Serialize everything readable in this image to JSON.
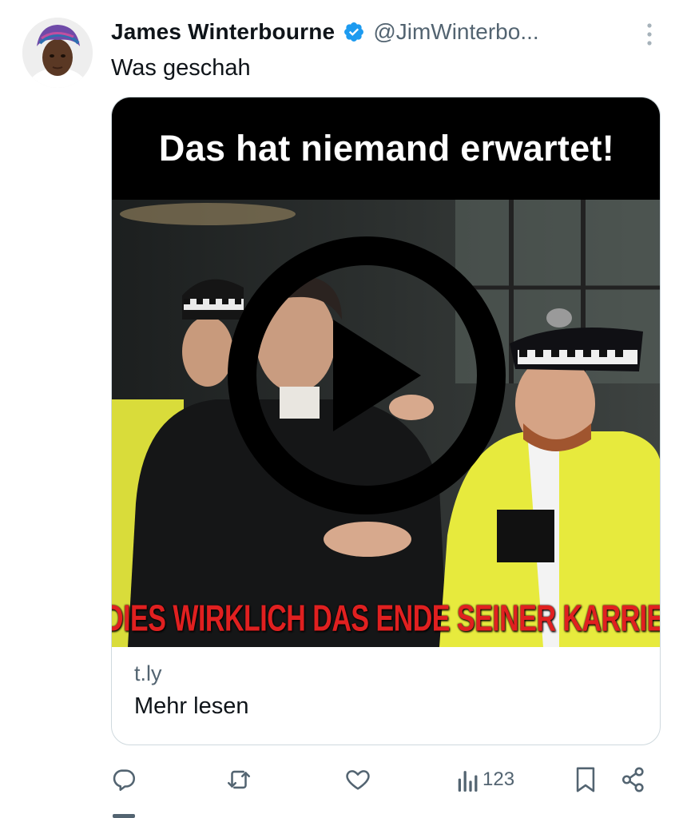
{
  "tweet": {
    "author": {
      "display_name": "James Winterbourne",
      "handle": "@JimWinterbo...",
      "verified": true,
      "avatar_icon": "profile-photo"
    },
    "text": "Was geschah",
    "more_icon": "more-vertical-icon"
  },
  "card": {
    "media_headline": "Das hat niemand erwartet!",
    "media_caption": "IST DIES WIRKLICH DAS ENDE SEINER KARRIERE?",
    "domain": "t.ly",
    "cta": "Mehr lesen",
    "play_icon": "play-icon"
  },
  "actions": {
    "reply_icon": "reply-icon",
    "retweet_icon": "retweet-icon",
    "like_icon": "heart-icon",
    "views_icon": "views-icon",
    "views_count": "123",
    "bookmark_icon": "bookmark-icon",
    "share_icon": "share-icon"
  },
  "colors": {
    "verified_blue": "#1d9bf0",
    "secondary_text": "#536471",
    "card_border": "#cfd9de",
    "caption_red": "#e02020"
  }
}
